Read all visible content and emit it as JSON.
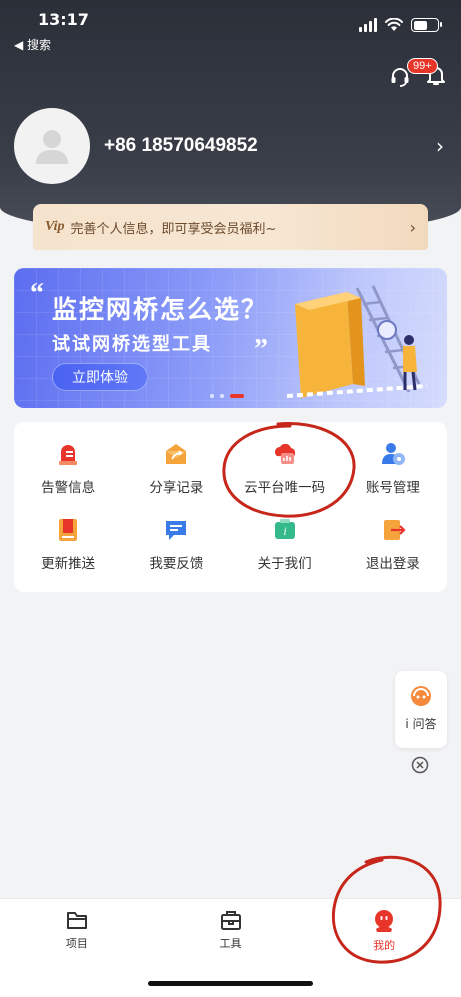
{
  "status_bar": {
    "time": "13:17",
    "back_label": "◀ 搜索"
  },
  "header": {
    "notification_badge": "99+",
    "phone": "+86 18570649852"
  },
  "vip": {
    "logo": "Vip",
    "text": "完善个人信息，即可享受会员福利~"
  },
  "banner": {
    "title": "监控网桥怎么选？",
    "subtitle": "试试网桥选型工具",
    "button": "立即体验",
    "dots": 3,
    "active_dot": 2
  },
  "menu": {
    "items": [
      {
        "label": "告警信息",
        "icon": "alarm-icon"
      },
      {
        "label": "分享记录",
        "icon": "share-icon"
      },
      {
        "label": "云平台唯一码",
        "icon": "cloud-code-icon"
      },
      {
        "label": "账号管理",
        "icon": "account-icon"
      },
      {
        "label": "更新推送",
        "icon": "update-icon"
      },
      {
        "label": "我要反馈",
        "icon": "feedback-icon"
      },
      {
        "label": "关于我们",
        "icon": "info-icon"
      },
      {
        "label": "退出登录",
        "icon": "logout-icon"
      }
    ]
  },
  "qa": {
    "label": "i 问答"
  },
  "tabbar": {
    "tabs": [
      {
        "label": "项目",
        "icon": "folder-icon"
      },
      {
        "label": "工具",
        "icon": "toolbox-icon"
      },
      {
        "label": "我的",
        "icon": "profile-mascot-icon",
        "active": true
      }
    ]
  },
  "colors": {
    "accent": "#e8352a",
    "header_dark": "#2b2f38",
    "vip_bg": "#f5e3cd",
    "banner_blue": "#5c6df0"
  }
}
